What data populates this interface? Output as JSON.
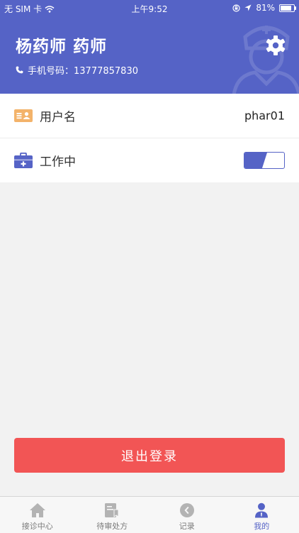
{
  "status_bar": {
    "carrier": "无 SIM 卡",
    "time": "上午9:52",
    "battery_percent": "81%",
    "battery_level": 0.81
  },
  "header": {
    "title": "杨药师  药师",
    "phone_label": "手机号码：",
    "phone_number": "13777857830"
  },
  "rows": {
    "username": {
      "label": "用户名",
      "value": "phar01",
      "icon": "id-card-icon"
    },
    "working": {
      "label": "工作中",
      "icon": "medical-kit-icon",
      "toggle_on": true
    }
  },
  "logout": {
    "label": "退出登录"
  },
  "tabs": [
    {
      "label": "接诊中心",
      "icon": "home-icon",
      "active": false
    },
    {
      "label": "待审处方",
      "icon": "prescription-icon",
      "active": false
    },
    {
      "label": "记录",
      "icon": "record-icon",
      "active": false
    },
    {
      "label": "我的",
      "icon": "profile-icon",
      "active": true
    }
  ],
  "colors": {
    "primary": "#5563c6",
    "danger": "#f25555",
    "id_card": "#f3b36a",
    "inactive_tab": "#b3b3b3"
  }
}
